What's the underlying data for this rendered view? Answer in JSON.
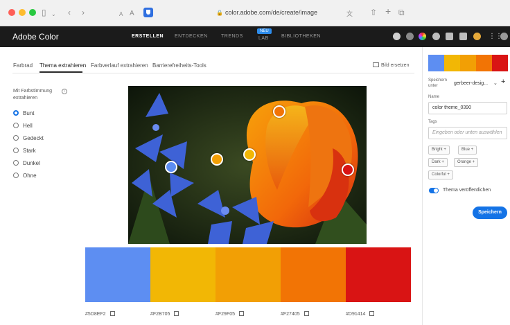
{
  "browser": {
    "url": "color.adobe.com/de/create/image",
    "icons": [
      "sidebar-icon",
      "back-icon",
      "forward-icon",
      "font-size-icon",
      "shield-icon",
      "share-icon",
      "new-tab-icon",
      "tabs-icon"
    ],
    "small_a": "A",
    "big_a": "A"
  },
  "header": {
    "brand": "Adobe Color",
    "nav": [
      {
        "label": "ERSTELLEN",
        "active": true
      },
      {
        "label": "ENTDECKEN",
        "active": false
      },
      {
        "label": "TRENDS",
        "active": false
      },
      {
        "label": "LAB",
        "active": false,
        "badge": "NEU"
      },
      {
        "label": "BIBLIOTHEKEN",
        "active": false
      }
    ]
  },
  "tabs": [
    {
      "label": "Farbrad",
      "active": false
    },
    {
      "label": "Thema extrahieren",
      "active": true
    },
    {
      "label": "Farbverlauf extrahieren",
      "active": false
    },
    {
      "label": "Barrierefreiheits-Tools",
      "active": false
    }
  ],
  "upload_label": "Bild ersetzen",
  "mood": {
    "title": "Mit Farbstimmung extrahieren",
    "options": [
      {
        "label": "Bunt",
        "selected": true
      },
      {
        "label": "Hell",
        "selected": false
      },
      {
        "label": "Gedeckt",
        "selected": false
      },
      {
        "label": "Stark",
        "selected": false
      },
      {
        "label": "Dunkel",
        "selected": false
      },
      {
        "label": "Ohne",
        "selected": false
      }
    ]
  },
  "swatches": [
    {
      "color": "#5D8EF2",
      "hex": "#5D8EF2"
    },
    {
      "color": "#F2B705",
      "hex": "#F2B705"
    },
    {
      "color": "#F29F05",
      "hex": "#F29F05"
    },
    {
      "color": "#F27405",
      "hex": "#F27405"
    },
    {
      "color": "#D91414",
      "hex": "#D91414"
    }
  ],
  "side": {
    "save_in_label": "Speichern unter",
    "library": "gerbeer-desig...",
    "name_label": "Name",
    "name_value": "color theme_0390",
    "tags_label": "Tags",
    "tags_placeholder": "Eingeben oder unten auswählen",
    "tags": [
      "Bright +",
      "Blue +",
      "Dark +",
      "Orange +",
      "Colorful +"
    ],
    "publish_label": "Thema veröffentlichen",
    "publish_on": true,
    "save_button": "Speichern"
  }
}
